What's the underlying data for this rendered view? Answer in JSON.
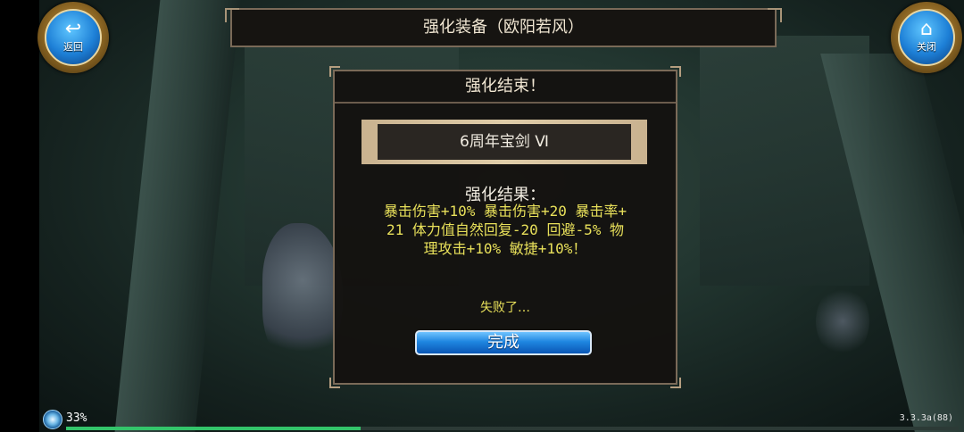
{
  "header": {
    "title": "强化装备（欧阳若风）",
    "back_label": "返回",
    "close_label": "关闭"
  },
  "dialog": {
    "title": "强化结束！",
    "item_name": "6周年宝剑 Ⅵ",
    "result_title": "强化结果：",
    "result_lines": [
      "暴击伤害+10% 暴击伤害+20 暴击率+",
      "21 体力值自然回复-20 回避-5% 物",
      "理攻击+10% 敏捷+10%！"
    ],
    "fail_message": "失败了…",
    "done_button": "完成"
  },
  "status": {
    "progress_text": "33%",
    "progress_fraction": 0.33,
    "version": "3.3.3a(88)"
  },
  "colors": {
    "result_text": "#e8e05a",
    "button_blue": "#1f86e0",
    "panel_border": "#7a6a58",
    "progress_fill": "#33c46a"
  },
  "icons": {
    "back": "back-arrow-icon",
    "close": "home-icon",
    "loading": "loading-orb-icon"
  }
}
